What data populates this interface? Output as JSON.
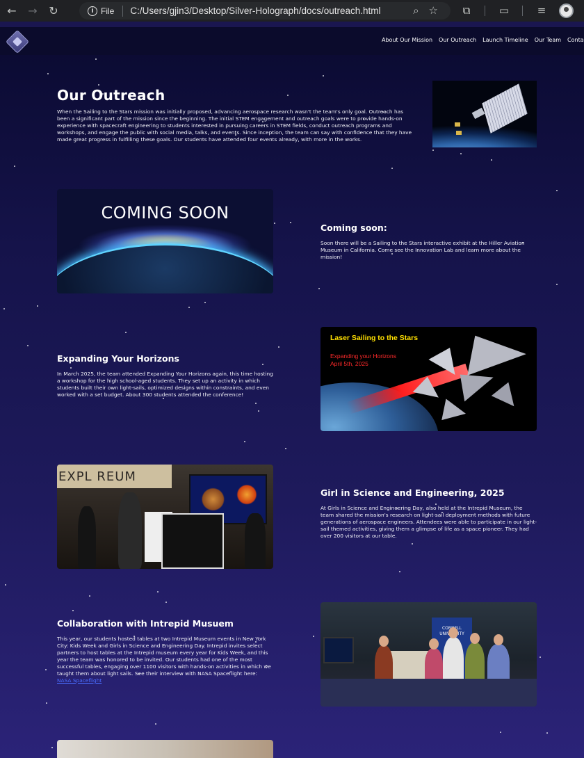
{
  "browser": {
    "file_label": "File",
    "url": "C:/Users/gjin3/Desktop/Silver-Holograph/docs/outreach.html"
  },
  "nav": {
    "links": [
      "About Our Mission",
      "Our Outreach",
      "Launch Timeline",
      "Our Team",
      "Contact"
    ]
  },
  "intro": {
    "title": "Our Outreach",
    "body": "When the Sailing to the Stars mission was initially proposed, advancing aerospace research wasn't the team's only goal. Outreach has been a significant part of the mission since the beginning. The initial STEM engagement and outreach goals were to provide hands-on experience with spacecraft engineering to students interested in pursuing careers in STEM fields, conduct outreach programs and workshops, and engage the public with social media, talks, and events. Since inception, the team can say with confidence that they have made great progress in fulfilling these goals. Our students have attended four events already, with more in the works."
  },
  "sections": [
    {
      "title": "Coming soon:",
      "body": "Soon there will be a Sailing to the Stars interactive exhibit at the Hiller Aviation Museum in California. Come see the Innovation Lab and learn more about the mission!",
      "image_text": "COMING SOON"
    },
    {
      "title": "Expanding Your Horizons",
      "body": "In March 2025, the team attended Expanding Your Horizons again, this time hosting a workshop for the high school-aged students. They set up an activity in which students built their own light-sails, optimized designs within constraints, and even worked with a set budget. About 300 students attended the conference!",
      "image_title": "Laser Sailing to the Stars",
      "image_sub1": "Expanding your Horizons",
      "image_sub2": "April 5th, 2025"
    },
    {
      "title": "Girl in Science and Engineering, 2025",
      "body": "At Girls in Science and Engineering Day, also held at the Intrepid Museum, the team shared the mission's research on light-sail deployment methods with future generations of aerospace engineers. Attendees were able to participate in our light-sail themed activities, giving them a glimpse of life as a space pioneer. They had over 200 visitors at our table.",
      "image_text": "EXPL REUM"
    },
    {
      "title": "Collaboration with Intrepid Musuem",
      "body": "This year, our students hosted tables at two Intrepid Museum events in New York City: Kids Week and Girls in Science and Engineering Day. Intrepid invites select partners to host tables at the Intrepid museum every year for Kids Week, and this year the team was honored to be invited. Our students had one of the most successful tables, engaging over 1100 visitors with hands-on activities in which we taught them about light sails. See their interview with NASA Spaceflight here:",
      "link_text": "NASA Spaceflight",
      "image_text": "CORNELL UNIVERSITY"
    }
  ],
  "colors": {
    "background_top": "#0a0a30",
    "background_bottom": "#2b2378",
    "link": "#4a6cff",
    "laser_title": "#ffe000",
    "laser_sub": "#ff2a2a"
  }
}
